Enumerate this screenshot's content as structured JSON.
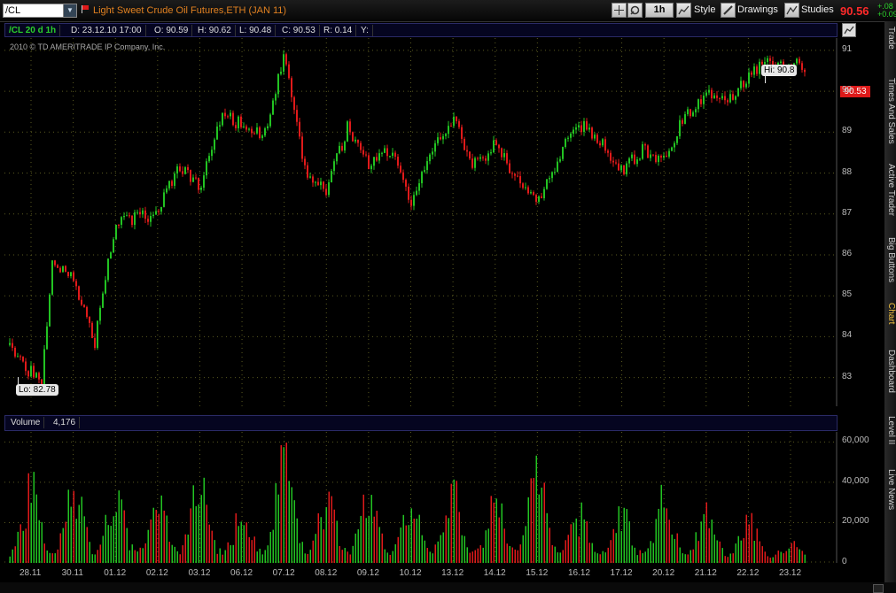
{
  "toolbar": {
    "symbol_value": "/CL",
    "instrument_title": "Light Sweet Crude Oil Futures,ETH (JAN 11)",
    "aggregation": "1h",
    "style_label": "Style",
    "drawings_label": "Drawings",
    "studies_label": "Studies",
    "last_price": "90.56",
    "change_abs": "+.08",
    "change_pct": "+0.09"
  },
  "infobar": {
    "chart_id": "/CL 20 d 1h",
    "date": "D: 23.12.10 17:00",
    "open": "O: 90.59",
    "high": "H: 90.62",
    "low": "L: 90.48",
    "close": "C: 90.53",
    "range": "R: 0.14",
    "y": "Y:"
  },
  "price_pane": {
    "copyright": "2010 © TD AMERITRADE IP Company, Inc.",
    "hi_label": "Hi: 90.8",
    "lo_label": "Lo: 82.78",
    "last_tag": "90.53",
    "y_ticks": [
      "91",
      "90",
      "89",
      "88",
      "87",
      "86",
      "85",
      "84",
      "83"
    ]
  },
  "volume_pane": {
    "label": "Volume",
    "value": "4,176",
    "y_ticks": [
      "60,000",
      "40,000",
      "20,000",
      "0"
    ]
  },
  "x_ticks": [
    "28.11",
    "30.11",
    "01.12",
    "02.12",
    "03.12",
    "06.12",
    "07.12",
    "08.12",
    "09.12",
    "10.12",
    "13.12",
    "14.12",
    "15.12",
    "16.12",
    "17.12",
    "20.12",
    "21.12",
    "22.12",
    "23.12"
  ],
  "sidebar_tabs": [
    "Trade",
    "Times And Sales",
    "Active Trader",
    "Big Buttons",
    "Chart",
    "Dashboard",
    "Level II",
    "Live News"
  ],
  "colors": {
    "up": "#22c322",
    "down": "#e01a1a",
    "grid": "#5a5a20",
    "accent": "#e08020"
  },
  "chart_data": {
    "type": "candlestick",
    "title": "Light Sweet Crude Oil Futures,ETH (JAN 11)",
    "interval": "1h",
    "price_range": [
      82.3,
      91.3
    ],
    "price_anchors": [
      {
        "x": "28.11",
        "price": 83.8
      },
      {
        "x": "28.11",
        "price": 82.78
      },
      {
        "x": "29.11",
        "price": 85.9
      },
      {
        "x": "30.11",
        "price": 85.5
      },
      {
        "x": "30.11",
        "price": 83.8
      },
      {
        "x": "01.12",
        "price": 86.8
      },
      {
        "x": "02.12",
        "price": 87.0
      },
      {
        "x": "02.12",
        "price": 88.2
      },
      {
        "x": "03.12",
        "price": 87.6
      },
      {
        "x": "03.12",
        "price": 89.4
      },
      {
        "x": "06.12",
        "price": 89.2
      },
      {
        "x": "06.12",
        "price": 88.9
      },
      {
        "x": "07.12",
        "price": 90.8
      },
      {
        "x": "07.12",
        "price": 88.0
      },
      {
        "x": "08.12",
        "price": 87.6
      },
      {
        "x": "08.12",
        "price": 89.1
      },
      {
        "x": "09.12",
        "price": 88.2
      },
      {
        "x": "09.12",
        "price": 88.6
      },
      {
        "x": "10.12",
        "price": 87.3
      },
      {
        "x": "10.12",
        "price": 88.5
      },
      {
        "x": "13.12",
        "price": 89.3
      },
      {
        "x": "13.12",
        "price": 88.2
      },
      {
        "x": "14.12",
        "price": 88.7
      },
      {
        "x": "14.12",
        "price": 87.9
      },
      {
        "x": "15.12",
        "price": 87.2
      },
      {
        "x": "15.12",
        "price": 88.4
      },
      {
        "x": "16.12",
        "price": 89.2
      },
      {
        "x": "16.12",
        "price": 88.8
      },
      {
        "x": "17.12",
        "price": 88.0
      },
      {
        "x": "17.12",
        "price": 88.6
      },
      {
        "x": "20.12",
        "price": 88.3
      },
      {
        "x": "20.12",
        "price": 89.4
      },
      {
        "x": "21.12",
        "price": 90.0
      },
      {
        "x": "21.12",
        "price": 89.8
      },
      {
        "x": "22.12",
        "price": 90.4
      },
      {
        "x": "22.12",
        "price": 90.8
      },
      {
        "x": "23.12",
        "price": 90.7
      },
      {
        "x": "23.12",
        "price": 90.53
      }
    ],
    "high": 90.8,
    "low": 82.78,
    "last": 90.53,
    "volume_range": [
      0,
      65000
    ],
    "volume_peaks": [
      {
        "x": "28.11",
        "volume": 45000
      },
      {
        "x": "30.11",
        "volume": 52000
      },
      {
        "x": "01.12",
        "volume": 40000
      },
      {
        "x": "02.12",
        "volume": 35000
      },
      {
        "x": "03.12",
        "volume": 48000
      },
      {
        "x": "06.12",
        "volume": 30000
      },
      {
        "x": "07.12",
        "volume": 60000
      },
      {
        "x": "08.12",
        "volume": 38000
      },
      {
        "x": "09.12",
        "volume": 40000
      },
      {
        "x": "10.12",
        "volume": 36000
      },
      {
        "x": "13.12",
        "volume": 42000
      },
      {
        "x": "14.12",
        "volume": 38000
      },
      {
        "x": "15.12",
        "volume": 55000
      },
      {
        "x": "16.12",
        "volume": 30000
      },
      {
        "x": "17.12",
        "volume": 28000
      },
      {
        "x": "20.12",
        "volume": 40000
      },
      {
        "x": "21.12",
        "volume": 35000
      },
      {
        "x": "22.12",
        "volume": 28000
      },
      {
        "x": "23.12",
        "volume": 8000
      }
    ],
    "volume_last": 4176
  }
}
